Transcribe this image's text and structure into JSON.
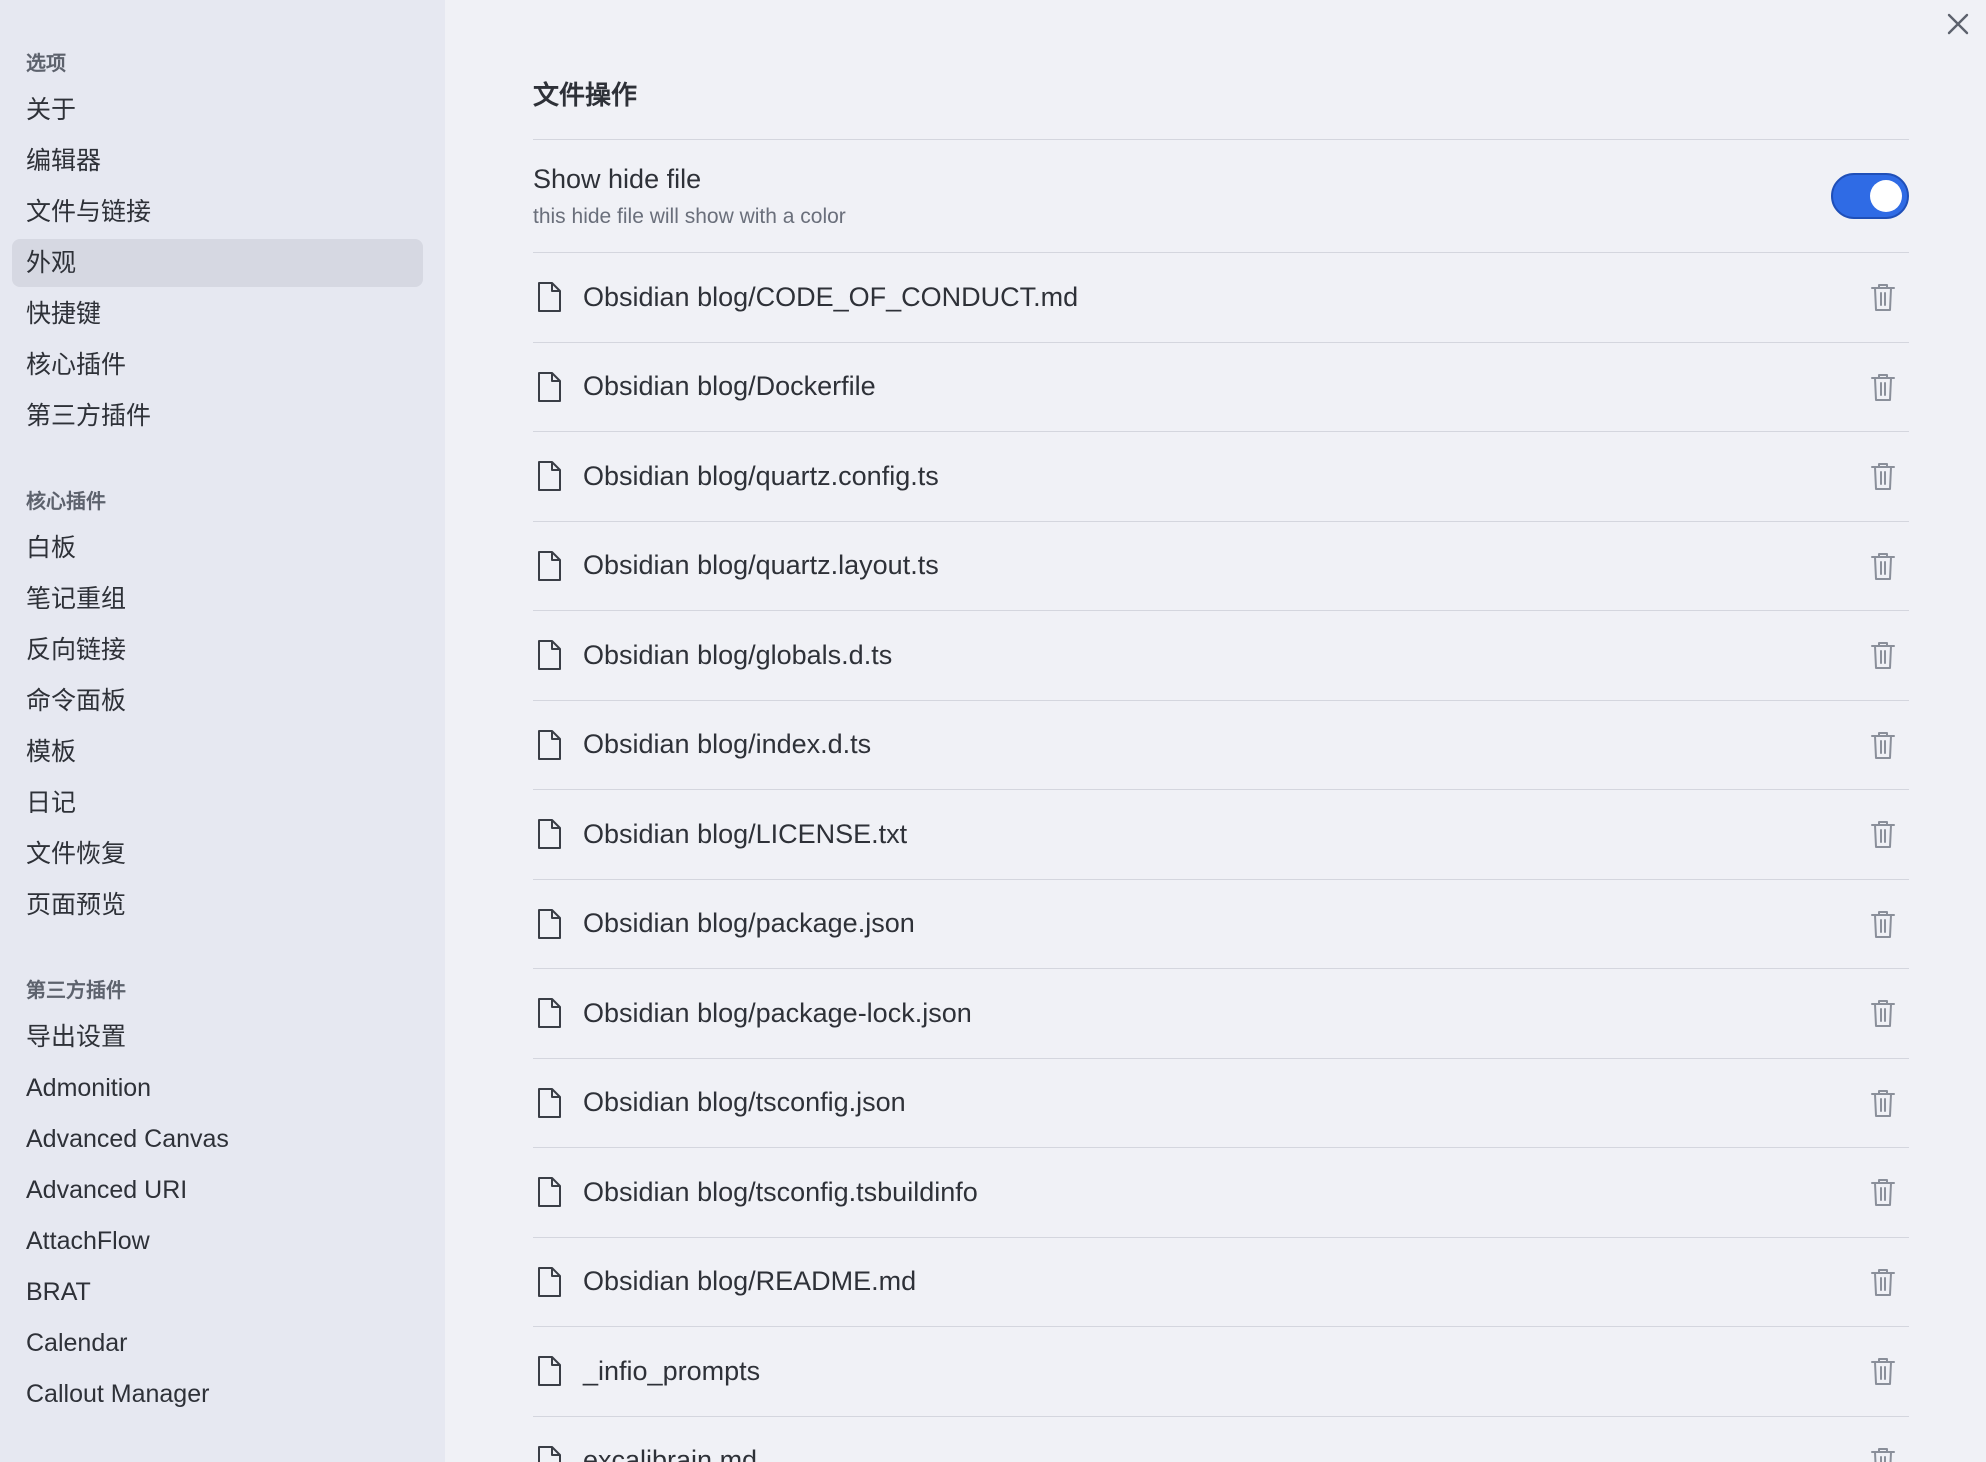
{
  "sidebar": {
    "groups": [
      {
        "title": "选项",
        "items": [
          "关于",
          "编辑器",
          "文件与链接",
          "外观",
          "快捷键",
          "核心插件",
          "第三方插件"
        ],
        "active_index": 3
      },
      {
        "title": "核心插件",
        "items": [
          "白板",
          "笔记重组",
          "反向链接",
          "命令面板",
          "模板",
          "日记",
          "文件恢复",
          "页面预览"
        ]
      },
      {
        "title": "第三方插件",
        "items": [
          "导出设置",
          "Admonition",
          "Advanced Canvas",
          "Advanced URI",
          "AttachFlow",
          "BRAT",
          "Calendar",
          "Callout Manager"
        ]
      }
    ]
  },
  "main": {
    "section_title": "文件操作",
    "setting": {
      "name": "Show hide file",
      "description": "this hide file will show with a color",
      "enabled": true
    },
    "files": [
      "Obsidian blog/CODE_OF_CONDUCT.md",
      "Obsidian blog/Dockerfile",
      "Obsidian blog/quartz.config.ts",
      "Obsidian blog/quartz.layout.ts",
      "Obsidian blog/globals.d.ts",
      "Obsidian blog/index.d.ts",
      "Obsidian blog/LICENSE.txt",
      "Obsidian blog/package.json",
      "Obsidian blog/package-lock.json",
      "Obsidian blog/tsconfig.json",
      "Obsidian blog/tsconfig.tsbuildinfo",
      "Obsidian blog/README.md",
      "_infio_prompts",
      "excalibrain.md"
    ]
  },
  "colors": {
    "accent": "#2f6be5",
    "sidebar_bg": "#e6e8f1",
    "main_bg": "#f0f1f6"
  }
}
